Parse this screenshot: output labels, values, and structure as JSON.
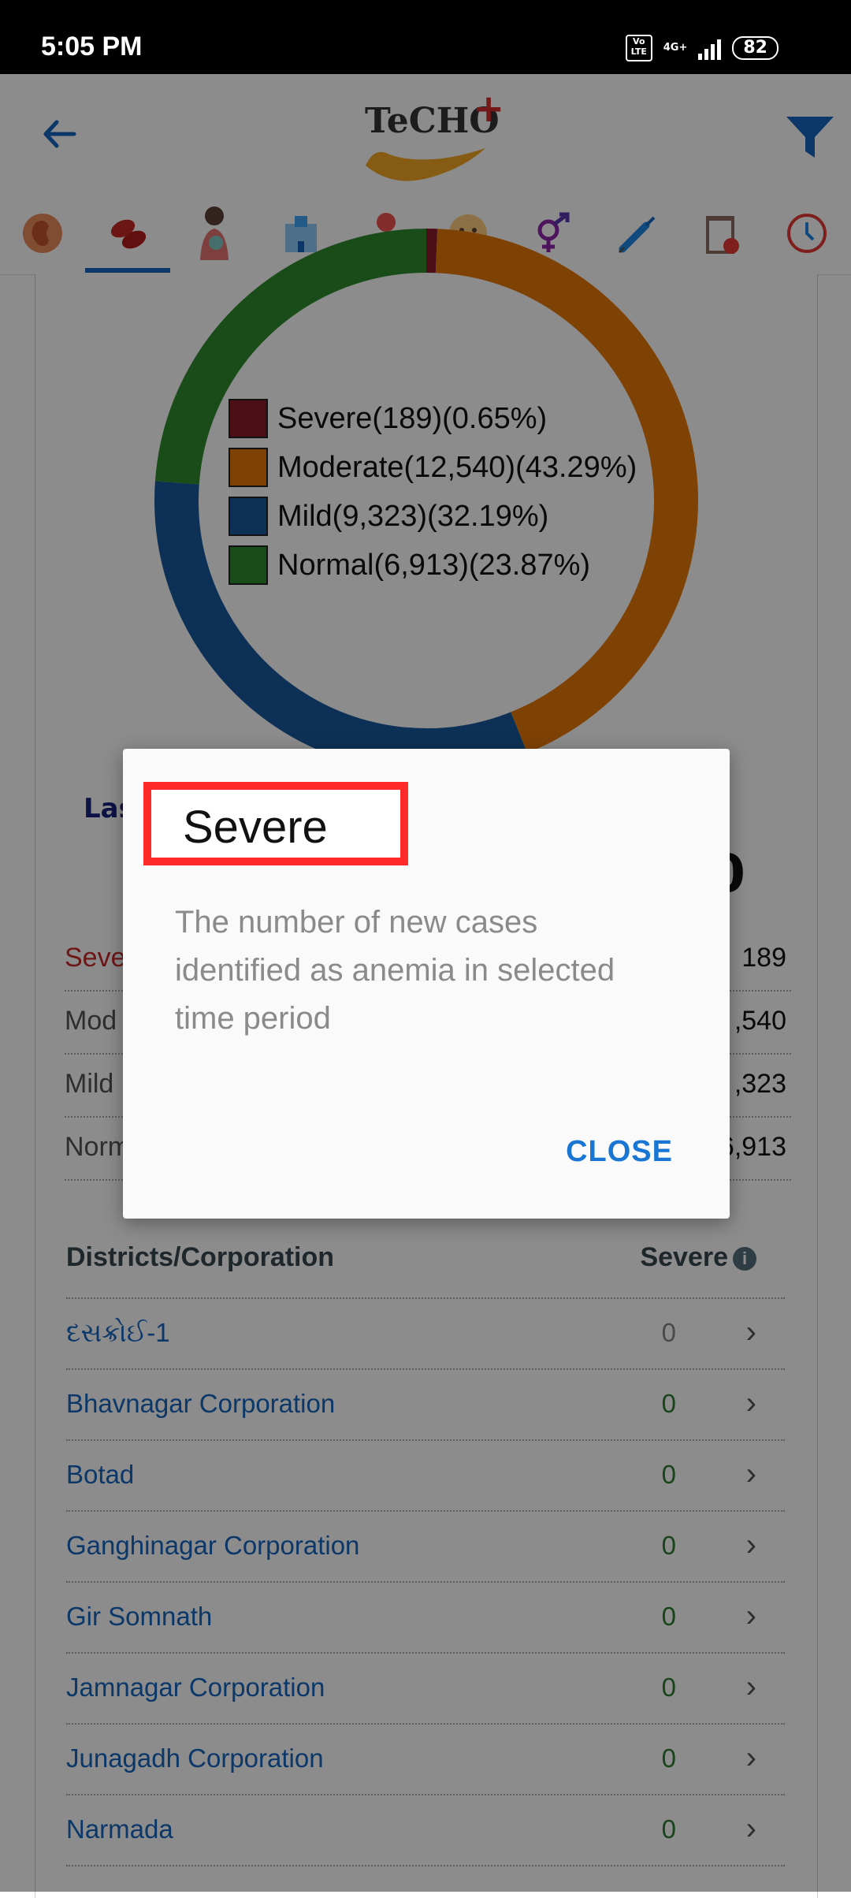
{
  "status_bar": {
    "time": "5:05 PM",
    "volte": "Vo LTE",
    "network": "4G+",
    "battery": "82"
  },
  "app_bar": {
    "logo_text": "TeCHO",
    "logo_plus": "+"
  },
  "tabs": [
    {
      "name": "kidney-icon"
    },
    {
      "name": "blood-cells-icon"
    },
    {
      "name": "mother-child-icon"
    },
    {
      "name": "hospital-icon"
    },
    {
      "name": "baby-scale-icon"
    },
    {
      "name": "baby-face-icon"
    },
    {
      "name": "gender-icon"
    },
    {
      "name": "syringe-icon"
    },
    {
      "name": "clipboard-icon"
    },
    {
      "name": "clock-icon"
    }
  ],
  "chart_data": {
    "type": "pie",
    "style": "donut",
    "categories": [
      "Severe",
      "Moderate",
      "Mild",
      "Normal"
    ],
    "values": [
      189,
      12540,
      9323,
      6913
    ],
    "percentages": [
      0.65,
      43.29,
      32.19,
      23.87
    ],
    "colors": [
      "#8b1a2b",
      "#e8780a",
      "#185a9d",
      "#2e8b2e"
    ],
    "legend": [
      {
        "label": "Severe(189)(0.65%)",
        "color": "#8b1a2b"
      },
      {
        "label": "Moderate(12,540)(43.29%)",
        "color": "#e8780a"
      },
      {
        "label": "Mild(9,323)(32.19%)",
        "color": "#185a9d"
      },
      {
        "label": "Normal(6,913)(23.87%)",
        "color": "#2e8b2e"
      }
    ]
  },
  "summary": {
    "partial_title": "Las",
    "partial_total": "0",
    "rows": [
      {
        "label": "Seve",
        "value": "189",
        "color": "#c62828"
      },
      {
        "label": "Mod",
        "value": ",540",
        "color": "#555555"
      },
      {
        "label": "Mild",
        "value": ",323",
        "color": "#555555"
      },
      {
        "label": "Norm",
        "value": "6,913",
        "color": "#555555"
      }
    ]
  },
  "districts": {
    "header_left": "Districts/Corporation",
    "header_right": "Severe",
    "info_icon": "i",
    "rows": [
      {
        "name": "દસક્રોઈ-1",
        "count": "0"
      },
      {
        "name": "Bhavnagar Corporation",
        "count": "0"
      },
      {
        "name": "Botad",
        "count": "0"
      },
      {
        "name": "Ganghinagar Corporation",
        "count": "0"
      },
      {
        "name": "Gir Somnath",
        "count": "0"
      },
      {
        "name": "Jamnagar Corporation",
        "count": "0"
      },
      {
        "name": "Junagadh Corporation",
        "count": "0"
      },
      {
        "name": "Narmada",
        "count": "0"
      }
    ],
    "first_count_color": "#888888",
    "count_color": "#2e7d32",
    "chevron": "›"
  },
  "dialog": {
    "title": "Severe",
    "message": "The number of new cases identified as anemia in selected time period",
    "close_label": "CLOSE"
  }
}
